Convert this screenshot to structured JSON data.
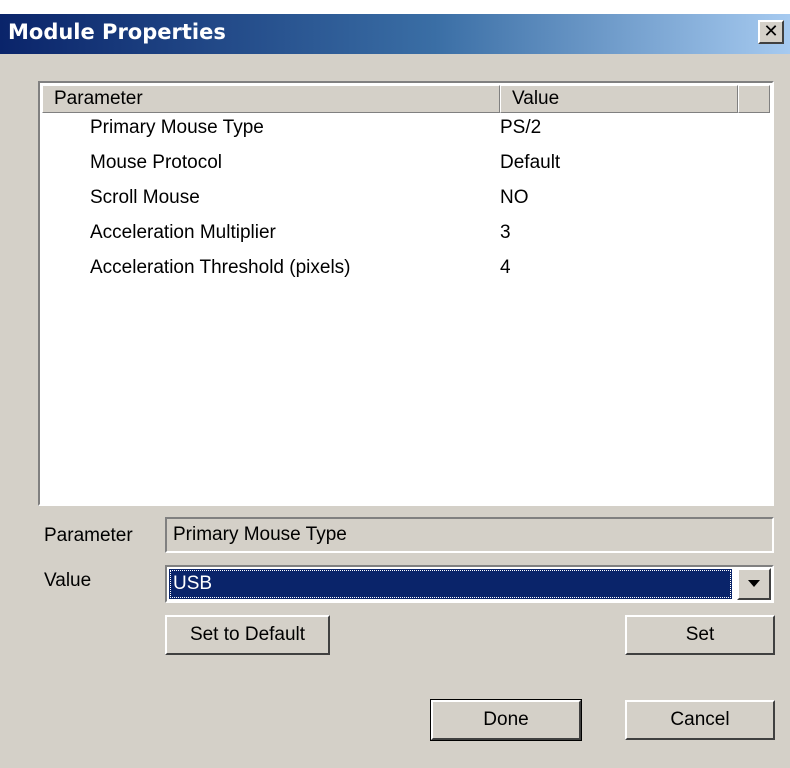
{
  "window": {
    "title": "Module Properties",
    "close_glyph": "✕"
  },
  "list": {
    "columns": [
      "Parameter",
      "Value"
    ],
    "rows": [
      {
        "parameter": "Primary Mouse Type",
        "value": "PS/2"
      },
      {
        "parameter": "Mouse Protocol",
        "value": "Default"
      },
      {
        "parameter": "Scroll Mouse",
        "value": "NO"
      },
      {
        "parameter": "Acceleration Multiplier",
        "value": "3"
      },
      {
        "parameter": "Acceleration Threshold (pixels)",
        "value": "4"
      }
    ]
  },
  "form": {
    "parameter_label": "Parameter",
    "parameter_value": "Primary Mouse Type",
    "value_label": "Value",
    "value_selected": "USB"
  },
  "buttons": {
    "set_default": "Set to Default",
    "set": "Set",
    "done": "Done",
    "cancel": "Cancel"
  },
  "colors": {
    "titlebar_start": "#0a246a",
    "titlebar_end": "#a6caf0",
    "dialog_face": "#d4d0c8",
    "selection": "#0a246a"
  }
}
